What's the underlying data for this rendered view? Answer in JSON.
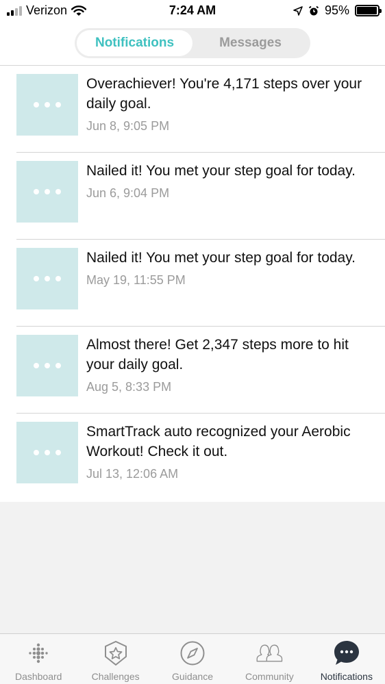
{
  "status_bar": {
    "carrier": "Verizon",
    "time": "7:24 AM",
    "battery": "95%",
    "battery_level": 0.95,
    "signal_bars": 2,
    "icons": [
      "wifi-icon",
      "location-arrow-icon",
      "alarm-icon",
      "battery-icon"
    ]
  },
  "segmented_tabs": [
    {
      "label": "Notifications",
      "active": true
    },
    {
      "label": "Messages",
      "active": false
    }
  ],
  "notifications": [
    {
      "message": "Overachiever! You're 4,171 steps over your daily goal.",
      "time": "Jun 8, 9:05 PM"
    },
    {
      "message": "Nailed it! You met your step goal for today.",
      "time": "Jun 6, 9:04 PM"
    },
    {
      "message": "Nailed it! You met your step goal for today.",
      "time": "May 19, 11:55 PM"
    },
    {
      "message": "Almost there! Get 2,347 steps more to hit your daily goal.",
      "time": "Aug 5, 8:33 PM"
    },
    {
      "message": "SmartTrack auto recognized your Aerobic Workout! Check it out.",
      "time": "Jul 13, 12:06 AM"
    }
  ],
  "tab_bar": [
    {
      "label": "Dashboard",
      "icon": "dashboard-dots-icon",
      "active": false
    },
    {
      "label": "Challenges",
      "icon": "star-badge-icon",
      "active": false
    },
    {
      "label": "Guidance",
      "icon": "compass-icon",
      "active": false
    },
    {
      "label": "Community",
      "icon": "people-icon",
      "active": false
    },
    {
      "label": "Notifications",
      "icon": "chat-bubble-icon",
      "active": true
    }
  ],
  "colors": {
    "accent": "#3fc1c0",
    "thumb_bg": "#cfe9ea",
    "muted_text": "#9b9b9b",
    "active_tab_icon": "#2b3440"
  }
}
